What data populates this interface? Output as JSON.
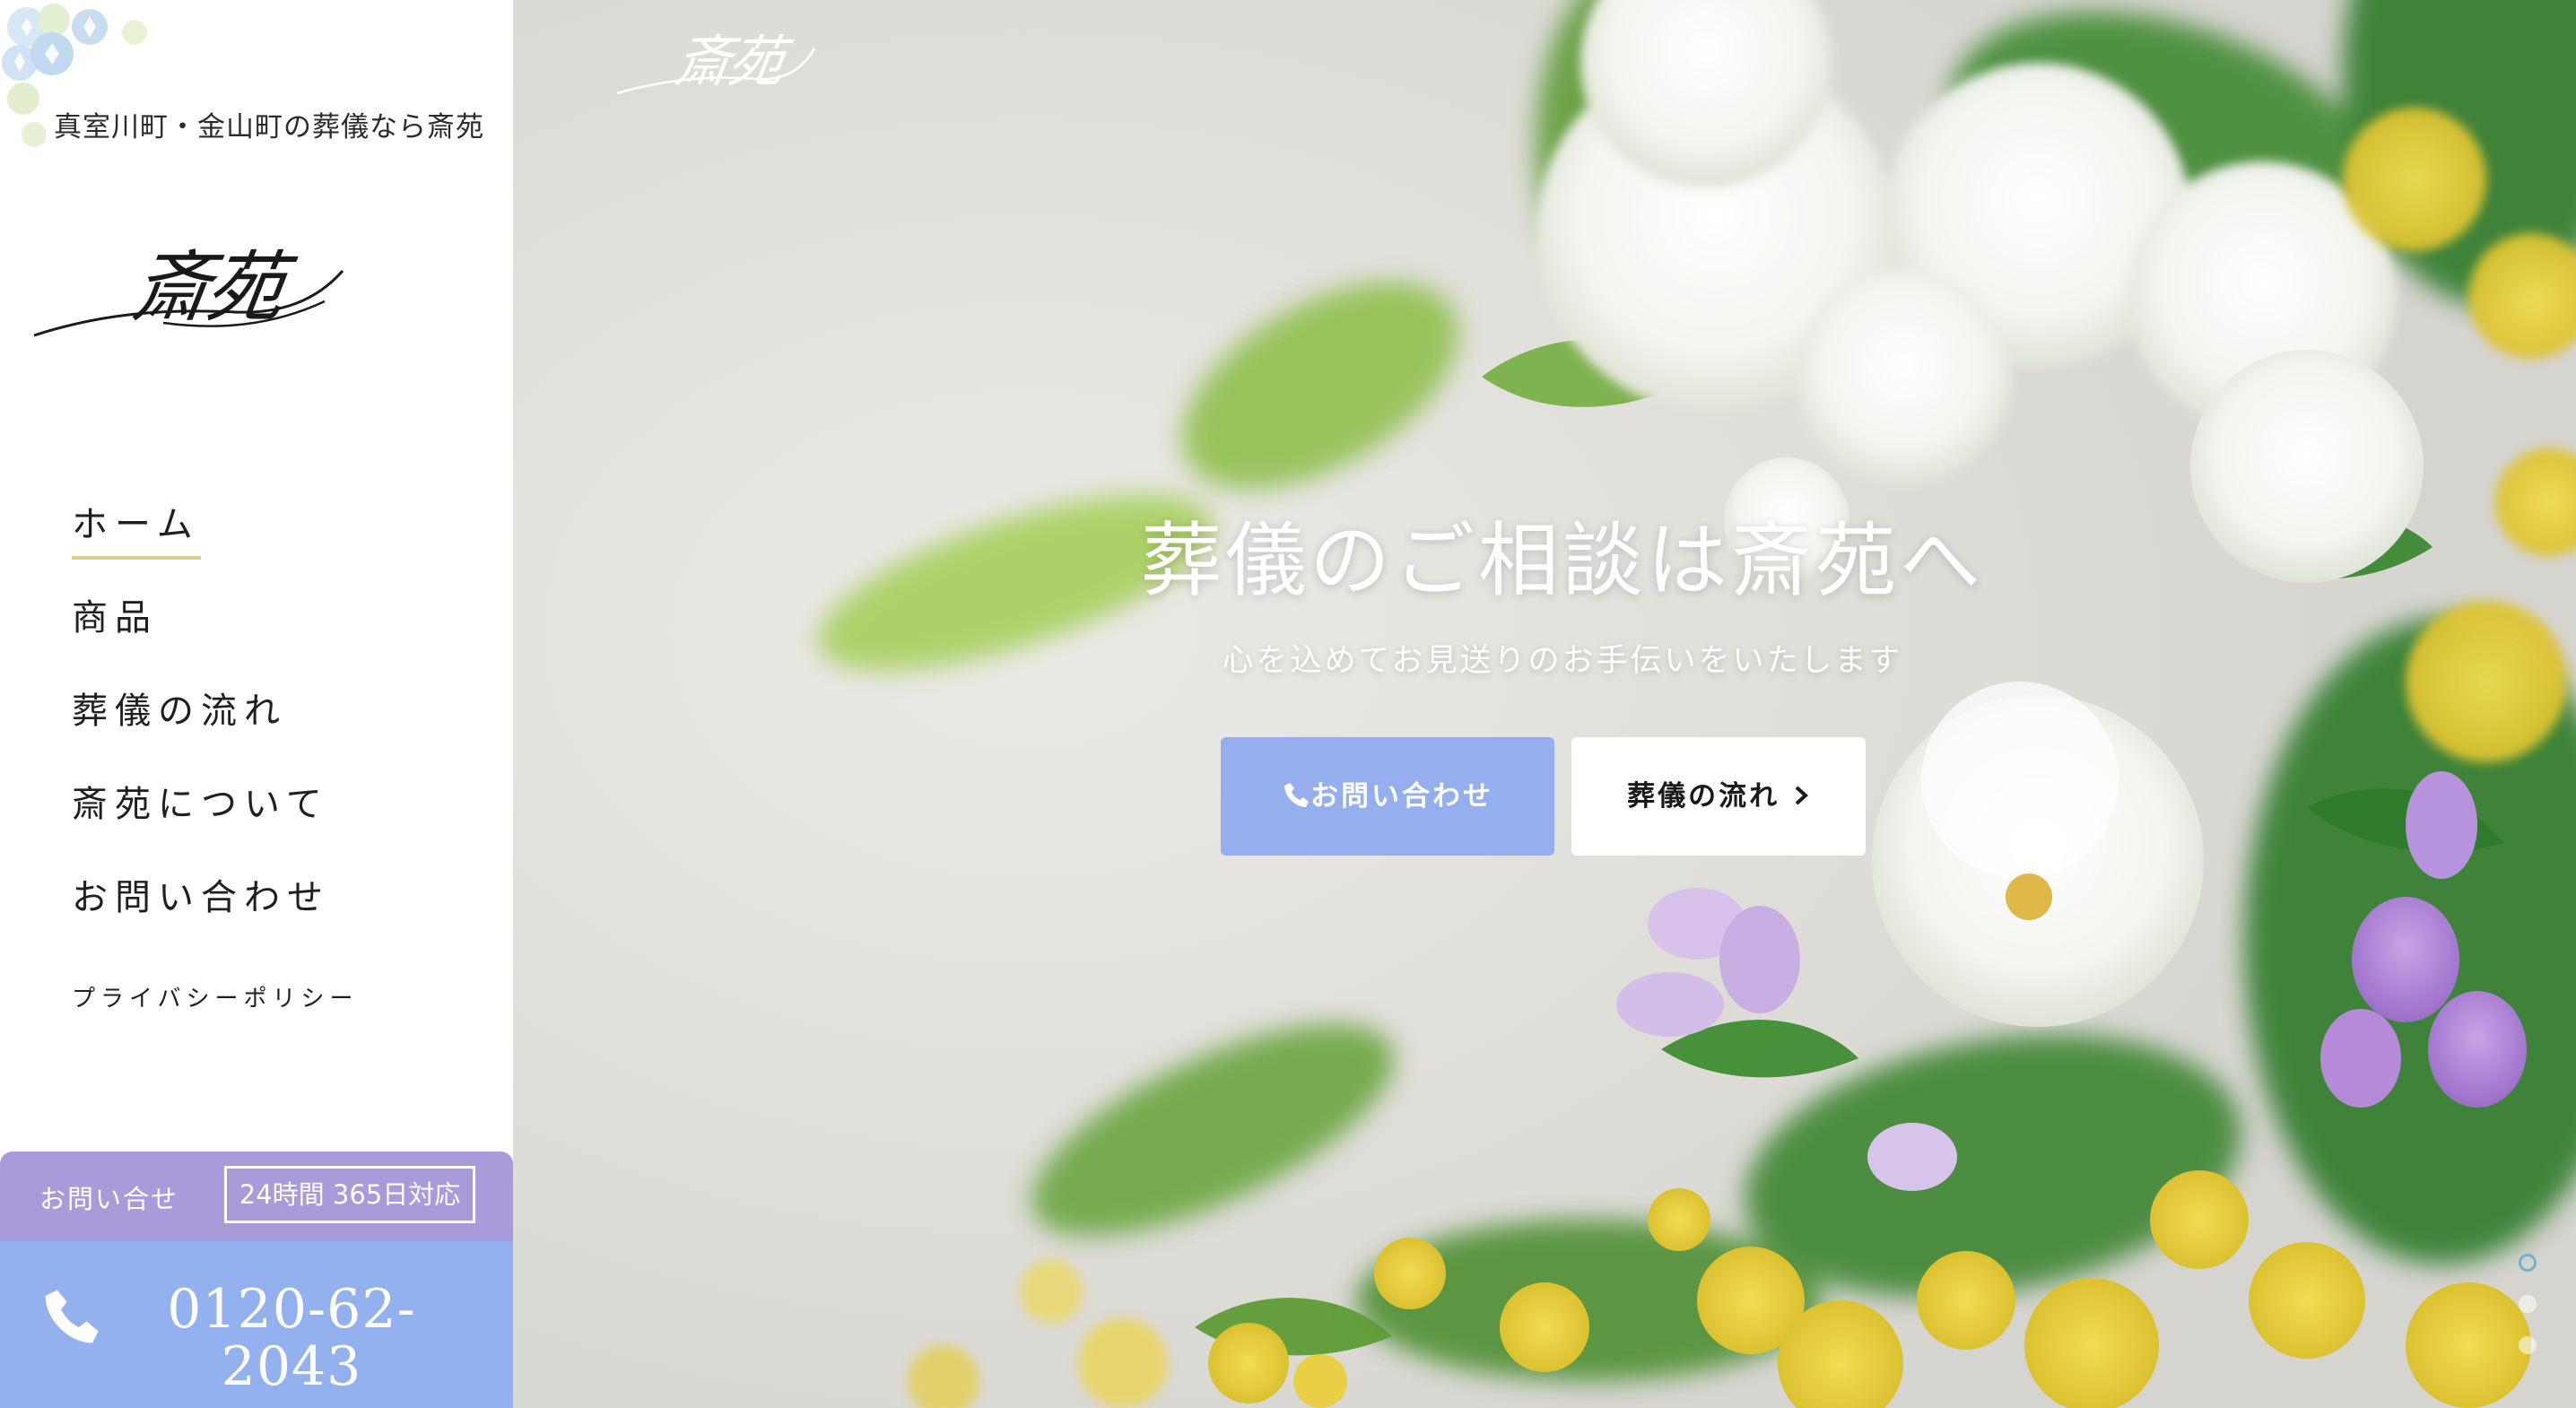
{
  "brand": {
    "tagline": "真室川町・金山町の葬儀なら斎苑",
    "logo_text": "斎苑"
  },
  "nav": {
    "items": [
      {
        "label": "ホーム",
        "active": true
      },
      {
        "label": "商品"
      },
      {
        "label": "葬儀の流れ"
      },
      {
        "label": "斎苑について"
      },
      {
        "label": "お問い合わせ"
      }
    ],
    "privacy_label": "プライバシーポリシー"
  },
  "contact": {
    "label": "お問い合せ",
    "hours": "24時間 365日対応",
    "phone": "0120-62-2043",
    "phone_icon": "phone-icon"
  },
  "hero": {
    "logo_text": "斎苑",
    "title": "葬儀のご相談は斎苑へ",
    "subtitle": "心を込めてお見送りのお手伝いをいたします",
    "buttons": {
      "contact_label": "お問い合わせ",
      "flow_label": "葬儀の流れ"
    },
    "slider": {
      "count": 3,
      "active_index": 0
    }
  },
  "colors": {
    "accent_blue": "#93b1ef",
    "accent_lavender": "#a99ad9",
    "active_underline": "#d9cf8f"
  }
}
